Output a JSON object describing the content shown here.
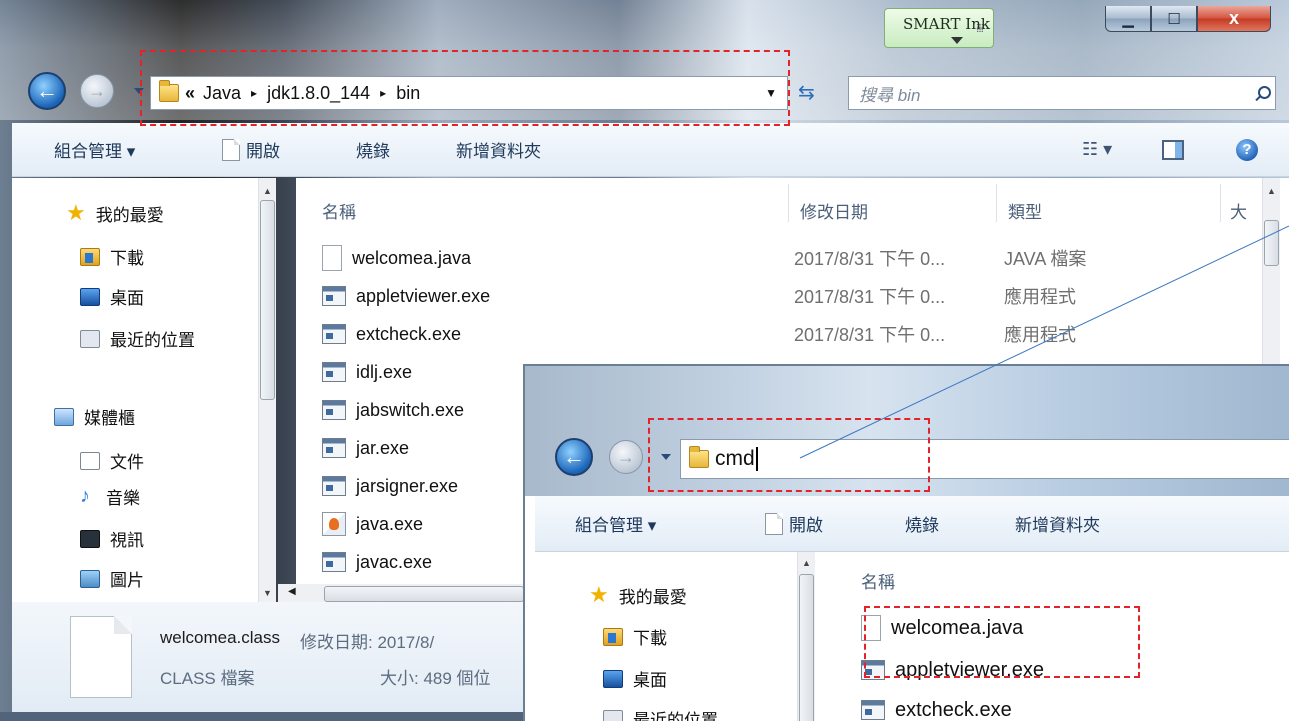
{
  "window": {
    "smart_ink": "SMART Ink",
    "caption": {
      "minimize": "▁",
      "maximize": "☐",
      "close": "x"
    }
  },
  "address_bar": {
    "chevron": "«",
    "crumbs": [
      "Java",
      "jdk1.8.0_144",
      "bin"
    ],
    "separator": "▸"
  },
  "search": {
    "placeholder": "搜尋 bin"
  },
  "toolbar": {
    "organize": "組合管理 ▾",
    "open": "開啟",
    "burn": "燒錄",
    "new_folder": "新增資料夾",
    "views": "☷ ▾",
    "help": "?"
  },
  "nav": {
    "favorites": "我的最愛",
    "downloads": "下載",
    "desktop": "桌面",
    "recent": "最近的位置",
    "libraries": "媒體櫃",
    "documents": "文件",
    "music": "音樂",
    "videos": "視訊",
    "pictures": "圖片"
  },
  "columns": {
    "name": "名稱",
    "date": "修改日期",
    "type": "類型",
    "size": "大"
  },
  "files": [
    {
      "name": "welcomea.java",
      "date": "2017/8/31 下午 0...",
      "type": "JAVA 檔案",
      "icon": "java-file-icon"
    },
    {
      "name": "appletviewer.exe",
      "date": "2017/8/31 下午 0...",
      "type": "應用程式",
      "icon": "exe-icon"
    },
    {
      "name": "extcheck.exe",
      "date": "2017/8/31 下午 0...",
      "type": "應用程式",
      "icon": "exe-icon"
    },
    {
      "name": "idlj.exe",
      "date": "",
      "type": "",
      "icon": "exe-icon"
    },
    {
      "name": "jabswitch.exe",
      "date": "",
      "type": "",
      "icon": "exe-icon"
    },
    {
      "name": "jar.exe",
      "date": "",
      "type": "",
      "icon": "exe-icon"
    },
    {
      "name": "jarsigner.exe",
      "date": "",
      "type": "",
      "icon": "exe-icon"
    },
    {
      "name": "java.exe",
      "date": "",
      "type": "",
      "icon": "java-exe-icon"
    },
    {
      "name": "javac.exe",
      "date": "",
      "type": "",
      "icon": "exe-icon"
    }
  ],
  "details": {
    "filename": "welcomea.class",
    "modified_label": "修改日期: 2017/8/",
    "filetype": "CLASS 檔案",
    "size_label": "大小: 489 個位"
  },
  "inset": {
    "address_value": "cmd",
    "toolbar": {
      "organize": "組合管理 ▾",
      "open": "開啟",
      "burn": "燒錄",
      "new_folder": "新增資料夾"
    },
    "nav": {
      "favorites": "我的最愛",
      "downloads": "下載",
      "desktop": "桌面",
      "recent": "最近的位置"
    },
    "column_name": "名稱",
    "files": [
      "welcomea.java",
      "appletviewer.exe",
      "extcheck.exe"
    ]
  },
  "colors": {
    "highlight": "#e3232a",
    "accent": "#1e5fb2"
  }
}
